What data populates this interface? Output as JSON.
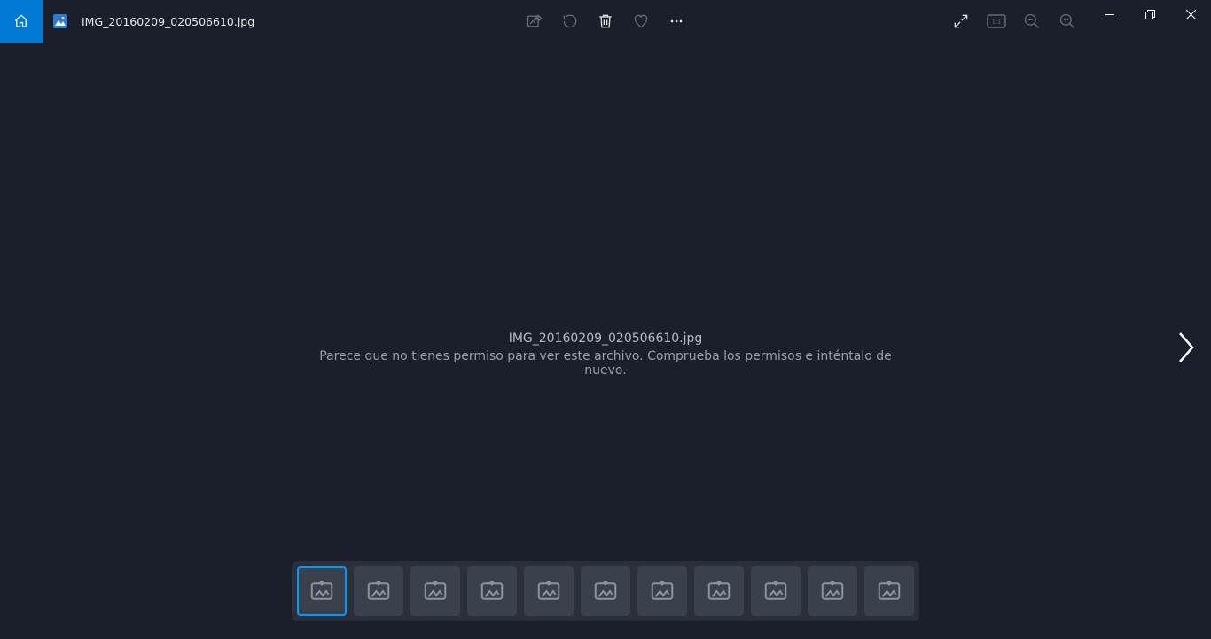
{
  "title": "IMG_20160209_020506610.jpg",
  "message": {
    "filename": "IMG_20160209_020506610.jpg",
    "error": "Parece que no tienes permiso para ver este archivo. Comprueba los permisos e inténtalo de nuevo."
  },
  "thumbnail_count": 11,
  "selected_thumbnail_index": 0
}
